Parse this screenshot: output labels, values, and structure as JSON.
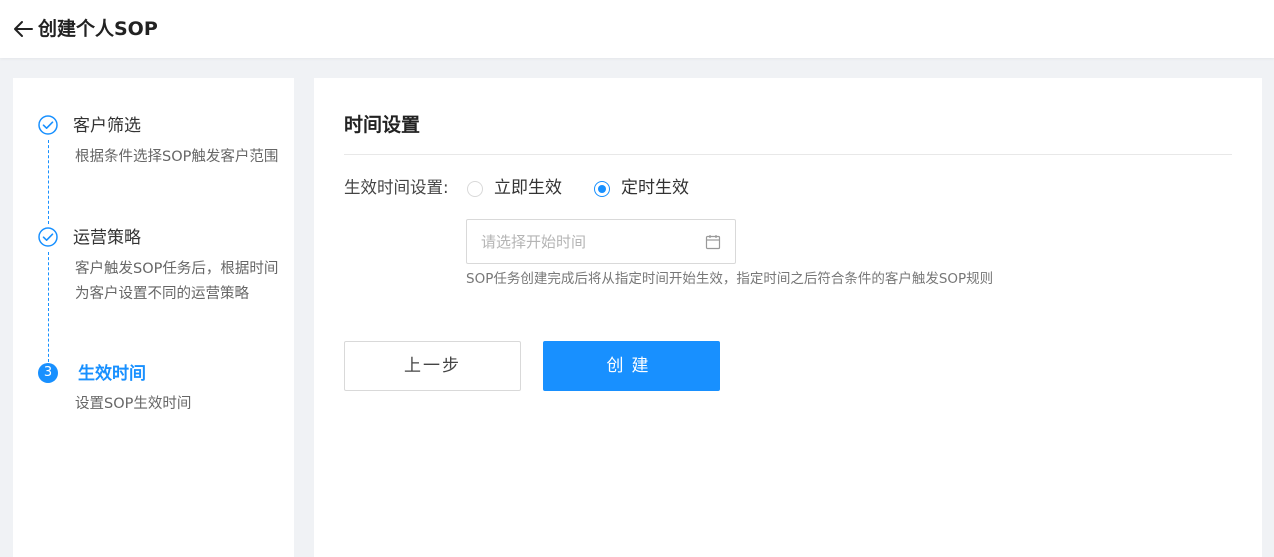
{
  "header": {
    "back_icon": "arrow-left-icon",
    "title": "创建个人SOP"
  },
  "steps": [
    {
      "status": "done",
      "icon": "check-circle-icon",
      "title": "客户筛选",
      "desc": "根据条件选择SOP触发客户范围"
    },
    {
      "status": "done",
      "icon": "check-circle-icon",
      "title": "运营策略",
      "desc": "客户触发SOP任务后，根据时间为客户设置不同的运营策略"
    },
    {
      "status": "active",
      "number": "3",
      "title": "生效时间",
      "desc": "设置SOP生效时间"
    }
  ],
  "form": {
    "section_title": "时间设置",
    "effective_label": "生效时间设置:",
    "options": [
      {
        "label": "立即生效",
        "checked": false
      },
      {
        "label": "定时生效",
        "checked": true
      }
    ],
    "date_placeholder": "请选择开始时间",
    "date_icon": "calendar-icon",
    "hint": "SOP任务创建完成后将从指定时间开始生效，指定时间之后符合条件的客户触发SOP规则"
  },
  "buttons": {
    "prev_label": "上一步",
    "create_label": "创建"
  },
  "colors": {
    "accent": "#1890ff",
    "background": "#f0f2f5"
  }
}
